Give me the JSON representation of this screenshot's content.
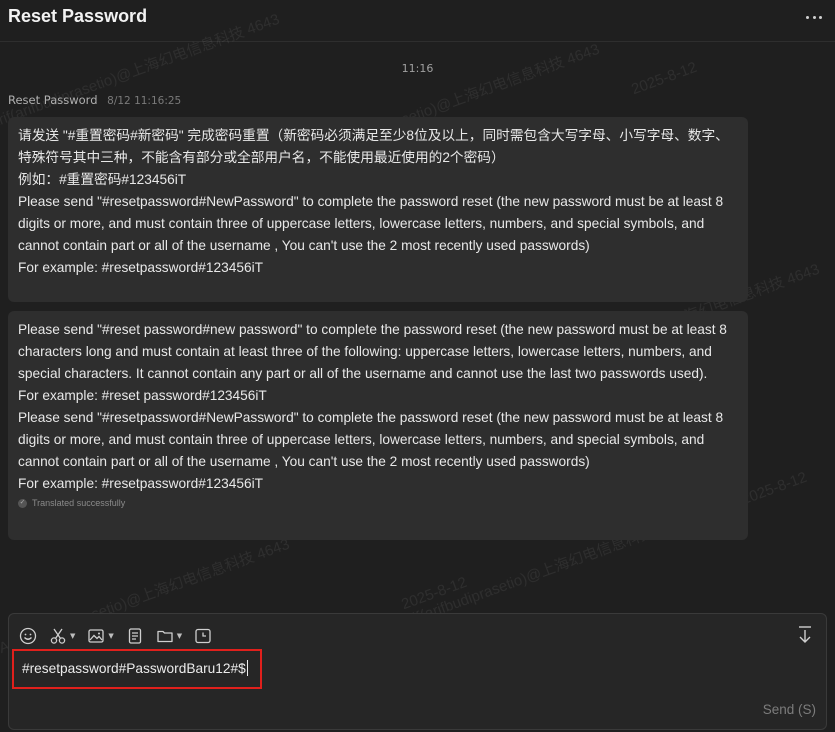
{
  "header": {
    "title": "Reset Password"
  },
  "chat": {
    "timestamp": "11:16",
    "sender": {
      "name": "Reset Password",
      "time": "8/12 11:16:25"
    },
    "messages": [
      {
        "lines": [
          "请发送 \"#重置密码#新密码\" 完成密码重置（新密码必须满足至少8位及以上，同时需包含大写字母、小写字母、数字、特殊符号其中三种，不能含有部分或全部用户名，不能使用最近使用的2个密码）",
          "例如：#重置密码#123456iT",
          "Please send \"#resetpassword#NewPassword\" to complete the password reset (the new password must be at least 8 digits or more, and must contain three of uppercase letters, lowercase letters, numbers, and special symbols, and cannot contain part or all of the username , You can't use the 2 most recently used passwords)",
          "For example: #resetpassword#123456iT"
        ]
      },
      {
        "lines": [
          "Please send \"#reset password#new password\" to complete the password reset (the new password must be at least 8 characters long and must contain at least three of the following: uppercase letters, lowercase letters, numbers, and special characters. It cannot contain any part or all of the username and cannot use the last two passwords used).",
          "For example: #reset password#123456iT",
          "Please send \"#resetpassword#NewPassword\" to complete the password reset (the new password must be at least 8 digits or more, and must contain three of uppercase letters, lowercase letters, numbers, and special symbols, and cannot contain part or all of the username , You can't use the 2 most recently used passwords)",
          "For example: #resetpassword#123456iT"
        ],
        "status": "Translated successfully"
      }
    ]
  },
  "watermarks": [
    "Arif(arifbudiprasetio)@上海幻电信息科技 4643",
    "2025-8-12"
  ],
  "composer": {
    "tools": [
      "emoji-icon",
      "scissors-icon",
      "image-icon",
      "document-icon",
      "folder-icon",
      "clock-icon"
    ],
    "input_value": "#resetpassword#PasswordBaru12#$",
    "send_label": "Send (S)"
  },
  "colors": {
    "background": "#1f1f1f",
    "bubble": "#2e2e2e",
    "highlight_border": "#e0201c"
  }
}
